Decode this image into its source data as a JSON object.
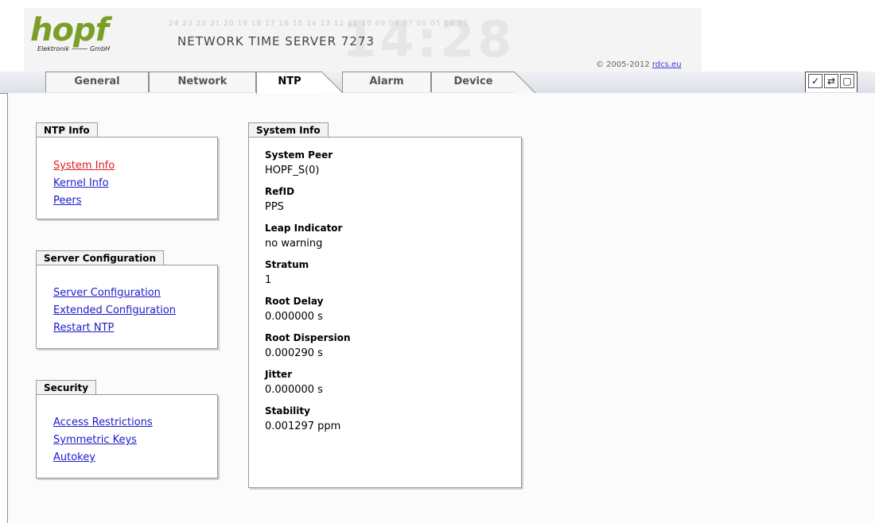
{
  "header": {
    "logo_text": "hopf",
    "logo_sub_left": "Elektronik",
    "logo_sub_right": "GmbH",
    "tick_numbers_left": "24 23 22 21 20 19 18 17 16 15 14 13 12 11 10",
    "tick_numbers_right": "09 08 07 06 05 04 01",
    "app_title": "NETWORK TIME SERVER 7273",
    "ghost_clock": "14:28",
    "copyright_prefix": "© 2005-2012",
    "copyright_link": "rdcs.eu"
  },
  "tabs": [
    {
      "label": "General"
    },
    {
      "label": "Network"
    },
    {
      "label": "NTP"
    },
    {
      "label": "Alarm"
    },
    {
      "label": "Device"
    }
  ],
  "toolbar": {
    "apply_icon": "check-icon",
    "reload_icon": "reload-icon",
    "save_icon": "save-icon",
    "apply_glyph": "✓",
    "reload_glyph": "⇄",
    "save_glyph": "▢"
  },
  "sidebar": {
    "ntp_info": {
      "title": "NTP Info",
      "links": [
        "System Info",
        "Kernel Info",
        "Peers"
      ]
    },
    "server_config": {
      "title": "Server Configuration",
      "links": [
        "Server Configuration",
        "Extended Configuration",
        "Restart NTP"
      ]
    },
    "security": {
      "title": "Security",
      "links": [
        "Access Restrictions",
        "Symmetric Keys",
        "Autokey"
      ]
    }
  },
  "system_info": {
    "title": "System Info",
    "fields": [
      {
        "label": "System Peer",
        "value": "HOPF_S(0)"
      },
      {
        "label": "RefID",
        "value": "PPS"
      },
      {
        "label": "Leap Indicator",
        "value": "no warning"
      },
      {
        "label": "Stratum",
        "value": "1"
      },
      {
        "label": "Root Delay",
        "value": "0.000000 s"
      },
      {
        "label": "Root Dispersion",
        "value": "0.000290 s"
      },
      {
        "label": "Jitter",
        "value": "0.000000 s"
      },
      {
        "label": "Stability",
        "value": "0.001297 ppm"
      }
    ]
  },
  "colors": {
    "logo_green": "#7a9f28",
    "link_blue": "#1a1acc",
    "link_active_red": "#e01b1b"
  }
}
